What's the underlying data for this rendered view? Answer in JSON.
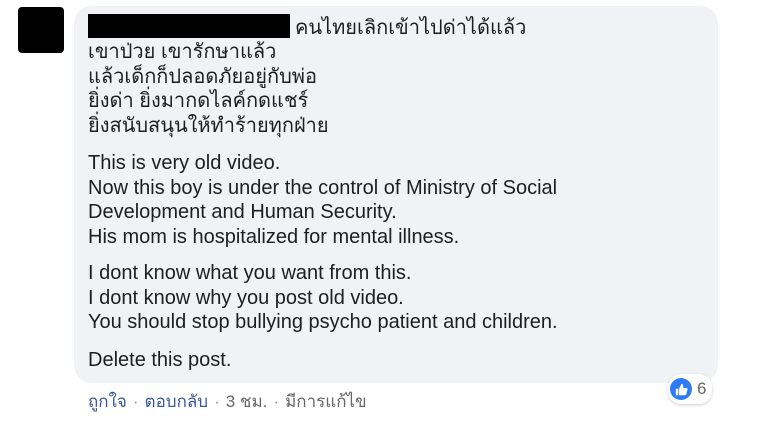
{
  "comment": {
    "header_text": "คนไทยเลิกเข้าไปด่าได้แล้ว",
    "paragraphs": [
      [
        "เขาป่วย เขารักษาแล้ว",
        "แล้วเด็กก็ปลอดภัยอยู่กับพ่อ",
        "ยิ่งด่า ยิ่งมากดไลค์กดแชร์",
        "ยิ่งสนับสนุนให้ทำร้ายทุกฝ่าย"
      ],
      [
        "This is very old video.",
        "Now this boy is under the control of Ministry of Social",
        "Development and Human Security.",
        "His mom is hospitalized for mental illness."
      ],
      [
        "I dont know what you want from this.",
        "I dont know why you post old video.",
        "You should stop bullying psycho patient and children."
      ],
      [
        "Delete this post."
      ]
    ],
    "reactions": {
      "icon": "like-icon",
      "count": "6",
      "color": "#2d7cf6"
    }
  },
  "actions": {
    "like": "ถูกใจ",
    "reply": "ตอบกลับ",
    "time": "3 ชม.",
    "edited": "มีการแก้ไข",
    "separator": "·"
  },
  "colors": {
    "bubble": "#f0f2f5",
    "text": "#1c1e21",
    "link": "#385898",
    "meta": "#65676b"
  }
}
